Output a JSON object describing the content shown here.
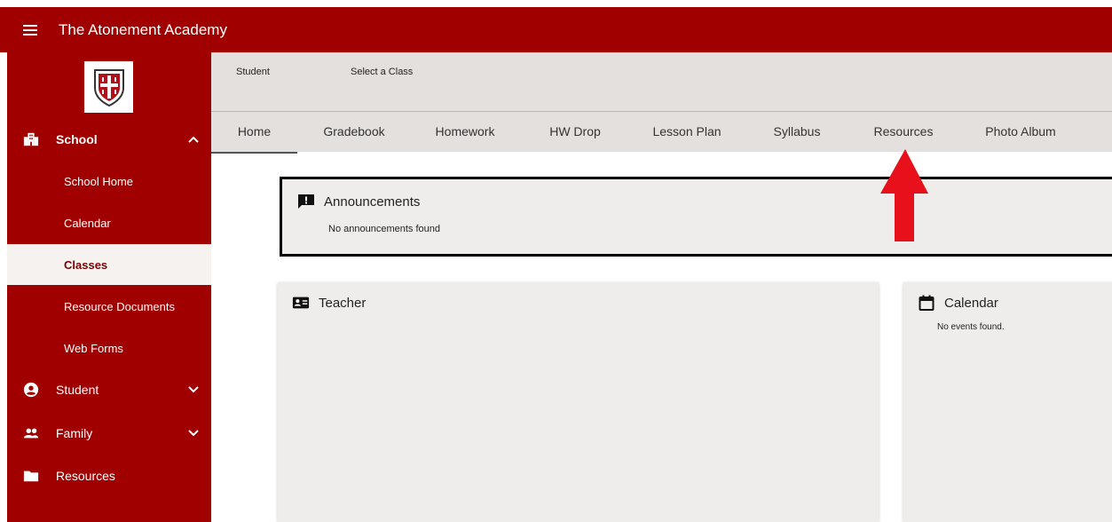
{
  "app": {
    "title": "The Atonement Academy"
  },
  "sidebar": {
    "school": {
      "label": "School",
      "chevron": "^"
    },
    "items": [
      {
        "label": "School Home"
      },
      {
        "label": "Calendar"
      },
      {
        "label": "Classes"
      },
      {
        "label": "Resource Documents"
      },
      {
        "label": "Web Forms"
      }
    ],
    "student": {
      "label": "Student"
    },
    "family": {
      "label": "Family"
    },
    "resources": {
      "label": "Resources"
    }
  },
  "subheader": {
    "student_label": "Student",
    "select_label": "Select a Class"
  },
  "tabs": [
    {
      "label": "Home"
    },
    {
      "label": "Gradebook"
    },
    {
      "label": "Homework"
    },
    {
      "label": "HW Drop"
    },
    {
      "label": "Lesson Plan"
    },
    {
      "label": "Syllabus"
    },
    {
      "label": "Resources"
    },
    {
      "label": "Photo Album"
    }
  ],
  "announcements": {
    "title": "Announcements",
    "empty": "No announcements found"
  },
  "teacher": {
    "title": "Teacher"
  },
  "calendar": {
    "title": "Calendar",
    "empty": "No events found."
  },
  "colors": {
    "brand": "#a00000",
    "arrow": "#e8101a"
  }
}
